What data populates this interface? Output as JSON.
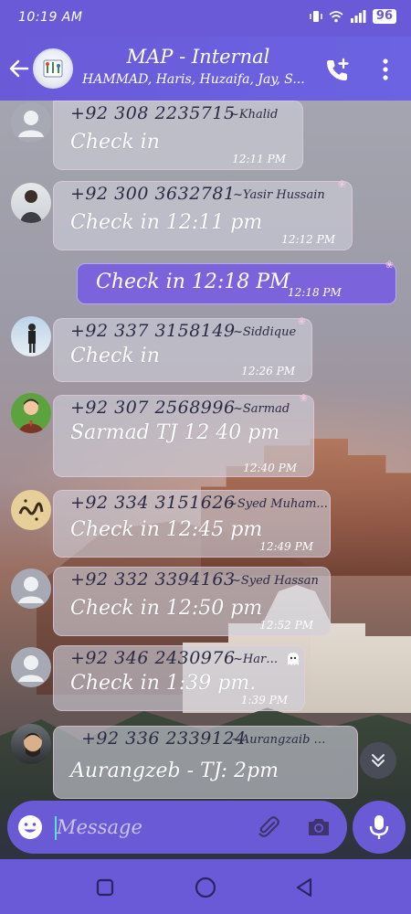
{
  "status_bar": {
    "time": "10:19 AM",
    "battery": "96"
  },
  "header": {
    "title": "MAP - Internal",
    "members": "HAMMAD, Haris, Huzaifa, Jay, S..."
  },
  "messages": [
    {
      "sender": "+92 308 2235715",
      "nick": "~Khalid",
      "text": "Check in",
      "time": "12:11 PM",
      "avatar": "default"
    },
    {
      "sender": "+92 300 3632781",
      "nick": "~Yasir Hussain",
      "text": "Check in 12:11 pm",
      "time": "12:12 PM",
      "avatar": "photo"
    },
    {
      "sender": "+92 337 3158149",
      "nick": "~Siddique",
      "text": "Check in",
      "time": "12:26 PM",
      "avatar": "photo"
    },
    {
      "sender": "+92 307 2568996",
      "nick": "~Sarmad",
      "text": "Sarmad TJ 12 40 pm",
      "time": "12:40 PM",
      "avatar": "photo"
    },
    {
      "sender": "+92 334 3151626",
      "nick": "~Syed Muham...",
      "text": "Check in 12:45 pm",
      "time": "12:49 PM",
      "avatar": "photo"
    },
    {
      "sender": "+92 332 3394163",
      "nick": "~Syed Hassan",
      "text": "Check in 12:50 pm",
      "time": "12:52 PM",
      "avatar": "default"
    },
    {
      "sender": "+92 346 2430976",
      "nick": "~Haroon",
      "text": "Check in 1:39 pm.",
      "time": "1:39 PM",
      "avatar": "default"
    },
    {
      "sender": "+92 336 2339124",
      "nick": "~Aurangzaib A...",
      "text": "Aurangzeb - TJ: 2pm",
      "time": "",
      "avatar": "photo"
    }
  ],
  "own_message": {
    "text": "Check in 12:18 PM",
    "time": "12:18 PM"
  },
  "composer": {
    "placeholder": "Message"
  },
  "colors": {
    "primary": "#6a5ad8",
    "own_bubble": "#7b63dc",
    "incoming_bubble": "#cecedaA0"
  }
}
